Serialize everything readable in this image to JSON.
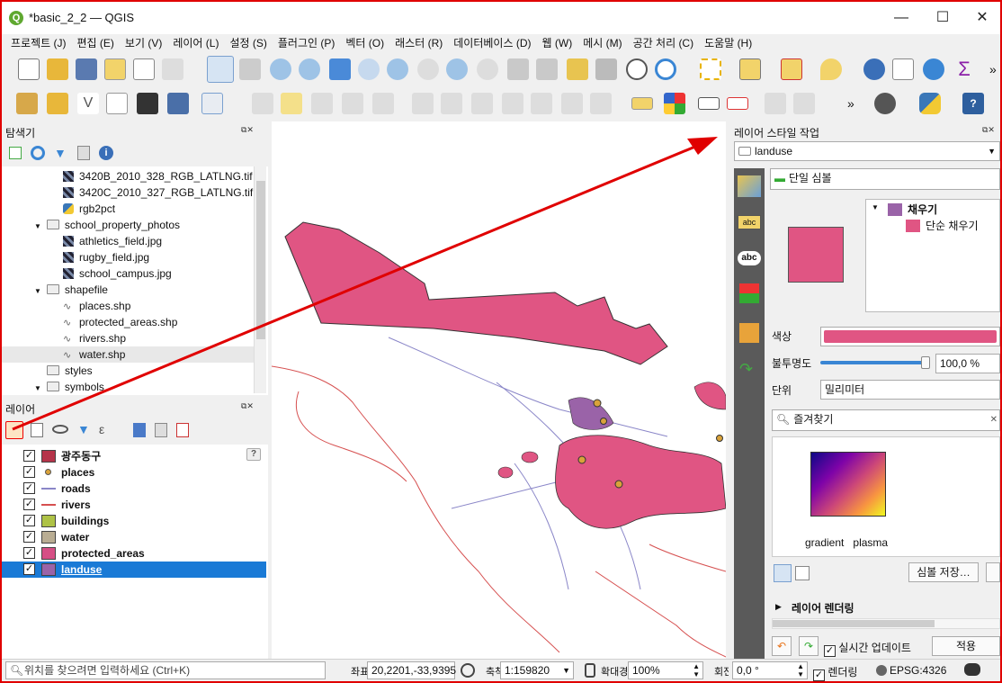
{
  "window": {
    "title": "*basic_2_2 — QGIS",
    "minimize": "—",
    "maximize": "☐",
    "close": "✕"
  },
  "menu": [
    "프로젝트 (J)",
    "편집 (E)",
    "보기 (V)",
    "레이어 (L)",
    "설정 (S)",
    "플러그인 (P)",
    "벡터 (O)",
    "래스터 (R)",
    "데이터베이스 (D)",
    "웹 (W)",
    "메시 (M)",
    "공간 처리 (C)",
    "도움말 (H)"
  ],
  "toolbar_more": "»",
  "browser": {
    "title": "탐색기",
    "items": [
      {
        "label": "3420B_2010_328_RGB_LATLNG.tif",
        "kind": "raster",
        "indent": 2
      },
      {
        "label": "3420C_2010_327_RGB_LATLNG.tif",
        "kind": "raster",
        "indent": 2
      },
      {
        "label": "rgb2pct",
        "kind": "python",
        "indent": 2
      },
      {
        "label": "school_property_photos",
        "kind": "folder",
        "indent": 1,
        "expanded": true
      },
      {
        "label": "athletics_field.jpg",
        "kind": "raster",
        "indent": 2
      },
      {
        "label": "rugby_field.jpg",
        "kind": "raster",
        "indent": 2
      },
      {
        "label": "school_campus.jpg",
        "kind": "raster",
        "indent": 2
      },
      {
        "label": "shapefile",
        "kind": "folder",
        "indent": 1,
        "expanded": true
      },
      {
        "label": "places.shp",
        "kind": "shp",
        "indent": 2
      },
      {
        "label": "protected_areas.shp",
        "kind": "shp",
        "indent": 2
      },
      {
        "label": "rivers.shp",
        "kind": "shp",
        "indent": 2
      },
      {
        "label": "water.shp",
        "kind": "shp",
        "indent": 2,
        "selected": true
      },
      {
        "label": "styles",
        "kind": "folder",
        "indent": 1
      },
      {
        "label": "symbols",
        "kind": "folder",
        "indent": 1,
        "expanded": true
      }
    ]
  },
  "layers": {
    "title": "레이어",
    "help_badge": "?",
    "items": [
      {
        "label": "광주동구",
        "color": "#b5344a",
        "sym": "fill",
        "checked": true
      },
      {
        "label": "places",
        "color": "#d9a23a",
        "sym": "point",
        "checked": true
      },
      {
        "label": "roads",
        "color": "#8a86c8",
        "sym": "line",
        "checked": true
      },
      {
        "label": "rivers",
        "color": "#d65050",
        "sym": "line",
        "checked": true
      },
      {
        "label": "buildings",
        "color": "#aec246",
        "sym": "fill",
        "checked": true
      },
      {
        "label": "water",
        "color": "#b9ad93",
        "sym": "fill",
        "checked": true
      },
      {
        "label": "protected_areas",
        "color": "#d64f85",
        "sym": "fill",
        "checked": true
      },
      {
        "label": "landuse",
        "color": "#9a63a8",
        "sym": "fill",
        "checked": true,
        "selected": true
      }
    ]
  },
  "style_panel": {
    "title": "레이어 스타일 작업",
    "layer_select": "landuse",
    "renderer": "단일 심볼",
    "tree": {
      "root": "채우기",
      "child": "단순 채우기"
    },
    "color_label": "색상",
    "color_value": "#e05583",
    "opacity_label": "불투명도",
    "opacity_value": "100,0 %",
    "opacity_fraction": 1.0,
    "unit_label": "단위",
    "unit_value": "밀리미터",
    "favorites": "즐겨찾기",
    "gradient_labels": [
      "gradient",
      "plasma"
    ],
    "save_symbol": "심볼 저장…",
    "layer_rendering": "레이어 렌더링",
    "live_update": "실시간 업데이트",
    "apply": "적용"
  },
  "status": {
    "locator_placeholder": "위치를 찾으려면 입력하세요 (Ctrl+K)",
    "coord_label": "좌표",
    "coordinate": "20,2201,-33,9395",
    "scale_label": "축척",
    "scale": "1:159820",
    "magnifier_label": "확대경",
    "magnifier": "100%",
    "rotation_label": "회전",
    "rotation": "0,0 °",
    "render_label": "렌더링",
    "crs": "EPSG:4326"
  },
  "colors": {
    "accent": "#e00000",
    "selection": "#1a7ad6",
    "fill": "#e05583"
  }
}
